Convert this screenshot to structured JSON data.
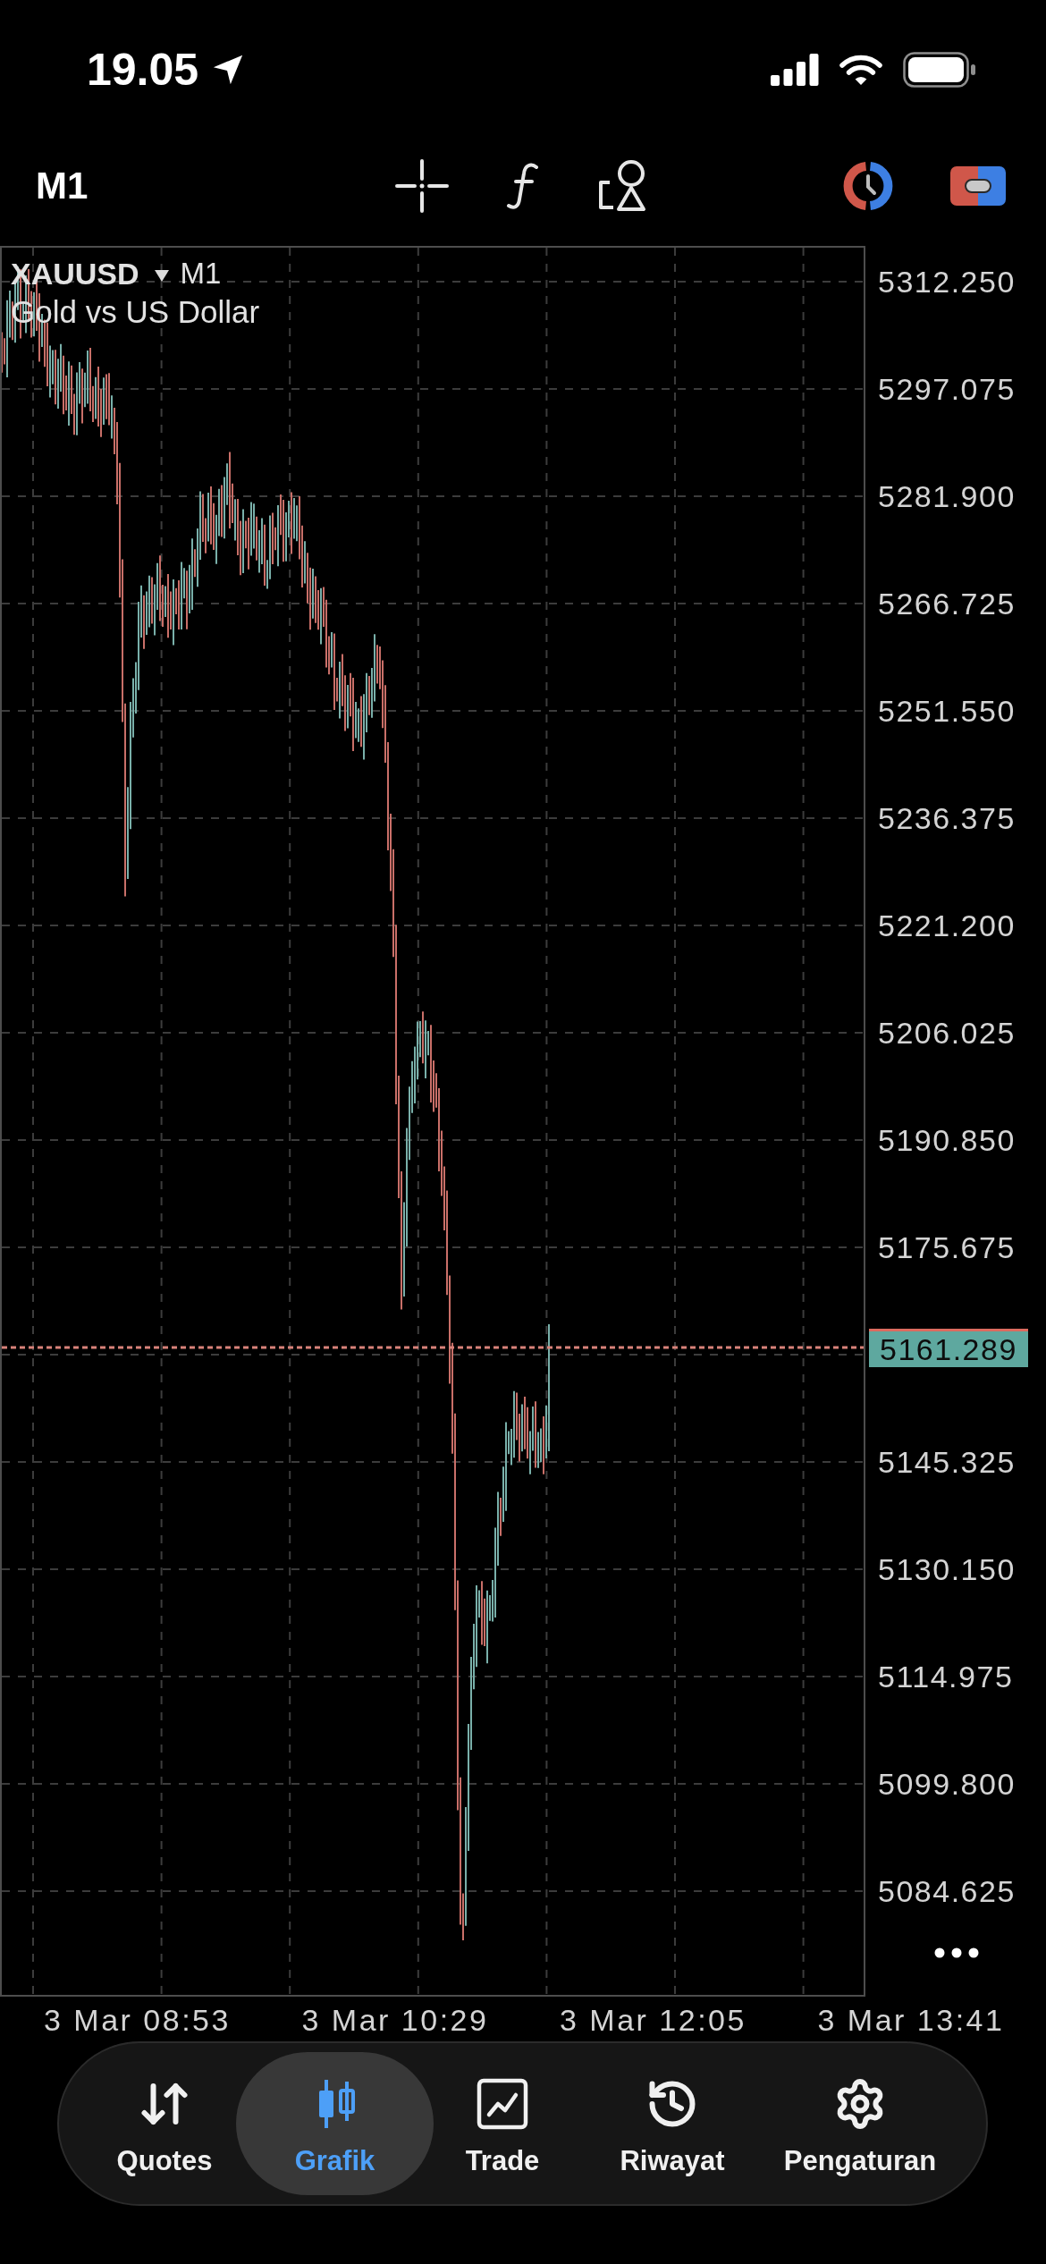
{
  "status_bar": {
    "time": "19.05"
  },
  "toolbar": {
    "timeframe": "M1"
  },
  "chart": {
    "symbol": "XAUUSD",
    "timeframe": "M1",
    "description": "Gold vs US Dollar",
    "price_axis": [
      {
        "kind": "tick",
        "label": "5312.250"
      },
      {
        "kind": "tick",
        "label": "5297.075"
      },
      {
        "kind": "tick",
        "label": "5281.900"
      },
      {
        "kind": "tick",
        "label": "5266.725"
      },
      {
        "kind": "tick",
        "label": "5251.550"
      },
      {
        "kind": "tick",
        "label": "5236.375"
      },
      {
        "kind": "tick",
        "label": "5221.200"
      },
      {
        "kind": "tick",
        "label": "5206.025"
      },
      {
        "kind": "tick",
        "label": "5190.850"
      },
      {
        "kind": "tick",
        "label": "5175.675"
      },
      {
        "kind": "current",
        "label": "5161.289"
      },
      {
        "kind": "tick",
        "label": "5145.325"
      },
      {
        "kind": "tick",
        "label": "5130.150"
      },
      {
        "kind": "tick",
        "label": "5114.975"
      },
      {
        "kind": "tick",
        "label": "5099.800"
      },
      {
        "kind": "tick",
        "label": "5084.625"
      }
    ],
    "time_axis": [
      "3 Mar 08:53",
      "3 Mar 10:29",
      "3 Mar 12:05",
      "3 Mar 13:41"
    ]
  },
  "tab_bar": {
    "tabs": [
      {
        "label": "Quotes",
        "selected": false
      },
      {
        "label": "Grafik",
        "selected": true
      },
      {
        "label": "Trade",
        "selected": false
      },
      {
        "label": "Riwayat",
        "selected": false
      },
      {
        "label": "Pengaturan",
        "selected": false
      }
    ]
  }
}
